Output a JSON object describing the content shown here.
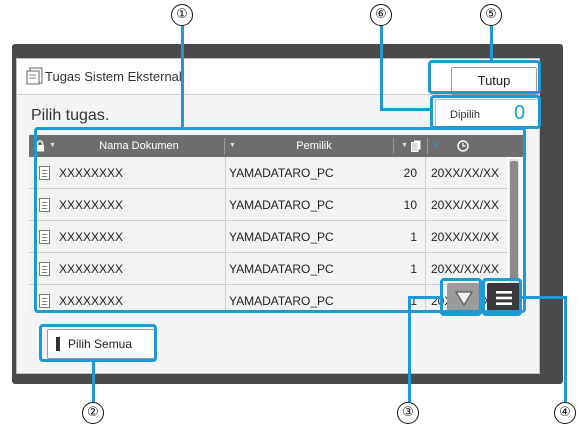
{
  "window": {
    "title": "Tugas Sistem Eksternal",
    "close_label": "Tutup"
  },
  "prompt": "Pilih tugas.",
  "selected": {
    "label": "Dipilih",
    "count": "0"
  },
  "table": {
    "headers": {
      "doc": "Nama Dokumen",
      "owner": "Pemilik"
    },
    "rows": [
      {
        "doc": "XXXXXXXX",
        "owner": "YAMADATARO_PC",
        "pages": "20",
        "date": "20XX/XX/XX"
      },
      {
        "doc": "XXXXXXXX",
        "owner": "YAMADATARO_PC",
        "pages": "10",
        "date": "20XX/XX/XX"
      },
      {
        "doc": "XXXXXXXX",
        "owner": "YAMADATARO_PC",
        "pages": "1",
        "date": "20XX/XX/XX"
      },
      {
        "doc": "XXXXXXXX",
        "owner": "YAMADATARO_PC",
        "pages": "1",
        "date": "20XX/XX/XX"
      },
      {
        "doc": "XXXXXXXX",
        "owner": "YAMADATARO_PC",
        "pages": "1",
        "date": "20XX/XX/XX"
      }
    ]
  },
  "select_all_label": "Pilih Semua",
  "callouts": {
    "c1": "①",
    "c2": "②",
    "c3": "③",
    "c4": "④",
    "c5": "⑤",
    "c6": "⑥"
  },
  "icons": {
    "lock": "lock-icon",
    "pages": "page-icon",
    "clock": "clock-icon",
    "scroll": "scroll-down-icon",
    "menu": "menu-icon"
  },
  "colors": {
    "highlight": "#1a9ad6",
    "header_bg": "#6e6e6e",
    "frame": "#4a4a4a"
  }
}
